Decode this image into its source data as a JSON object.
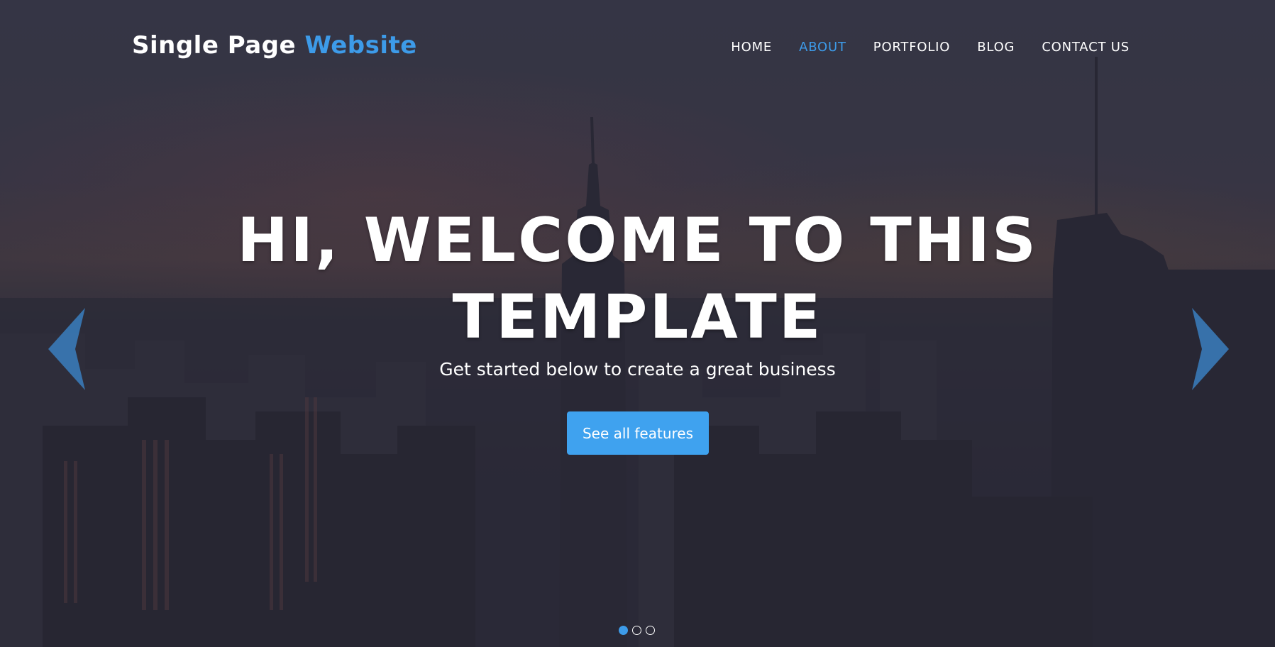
{
  "brand": {
    "name_part1": "Single Page",
    "name_part2": "Website",
    "accent_color": "#3d9be9"
  },
  "nav": {
    "items": [
      {
        "label": "HOME",
        "active": false
      },
      {
        "label": "ABOUT",
        "active": true
      },
      {
        "label": "PORTFOLIO",
        "active": false
      },
      {
        "label": "BLOG",
        "active": false
      },
      {
        "label": "CONTACT US",
        "active": false
      }
    ]
  },
  "hero": {
    "headline_line1": "HI, WELCOME TO THIS",
    "headline_line2": "TEMPLATE",
    "subtitle": "Get started below to create a great business",
    "cta_label": "See all features",
    "cta_color": "#3fa2ef",
    "prev_icon": "chevron-left-icon",
    "next_icon": "chevron-right-icon"
  },
  "carousel": {
    "slide_count": 3,
    "active_index": 0
  }
}
